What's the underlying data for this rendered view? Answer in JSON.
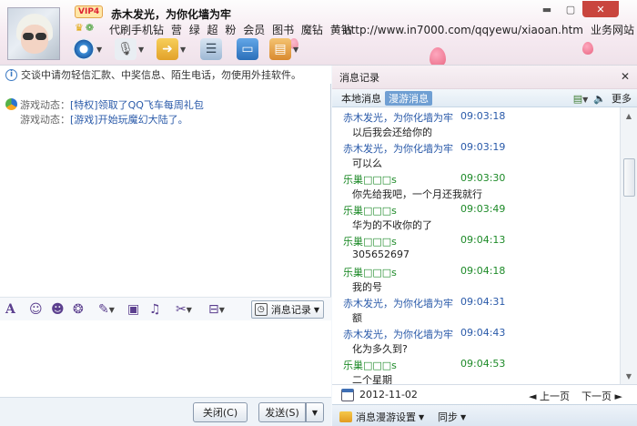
{
  "header": {
    "vip_badge": "VIP4",
    "nickname": "赤木发光，为你化墙为牢",
    "links": [
      "代刷手机钻",
      "营",
      "绿",
      "超",
      "粉",
      "会员",
      "图书",
      "魔钻",
      "黄钻"
    ],
    "url": "http://www.in7000.com/qqyewu/xiaoan.htm",
    "business_site": "业务网站"
  },
  "window_controls": [
    "▬",
    "▢",
    "✕"
  ],
  "notice": "交谈中请勿轻信汇款、中奖信息、陌生电话，勿使用外挂软件。",
  "game_updates": [
    {
      "label": "游戏动态：",
      "text": "[特权]领取了QQ飞车每周礼包"
    },
    {
      "label": "游戏动态：",
      "text": "[游戏]开始玩魔幻大陆了。"
    }
  ],
  "format_bar": {
    "message_record_label": "消息记录"
  },
  "bottom": {
    "close_label": "关闭(C)",
    "send_label": "发送(S)"
  },
  "history": {
    "title": "消息记录",
    "tab_local": "本地消息",
    "tab_roam": "漫游消息",
    "more": "更多",
    "entries": [
      {
        "sender": "赤木发光，为你化墙为牢",
        "time": "09:03:18",
        "text": "以后我会还给你的",
        "color": "blue"
      },
      {
        "sender": "赤木发光，为你化墙为牢",
        "time": "09:03:19",
        "text": "可以么",
        "color": "blue"
      },
      {
        "sender": "乐巢□□□s",
        "time": "09:03:30",
        "text": "你先给我吧，一个月还我就行",
        "color": "green"
      },
      {
        "sender": "乐巢□□□s",
        "time": "09:03:49",
        "text": "华为的不收你的了",
        "color": "green"
      },
      {
        "sender": "乐巢□□□s",
        "time": "09:04:13",
        "text": "305652697",
        "color": "green"
      },
      {
        "sender": "乐巢□□□s",
        "time": "09:04:18",
        "text": "我的号",
        "color": "green"
      },
      {
        "sender": "赤木发光，为你化墙为牢",
        "time": "09:04:31",
        "text": "额",
        "color": "blue"
      },
      {
        "sender": "赤木发光，为你化墙为牢",
        "time": "09:04:43",
        "text": "化为多久到?",
        "color": "blue"
      },
      {
        "sender": "乐巢□□□s",
        "time": "09:04:53",
        "text": "二个星期",
        "color": "green"
      }
    ],
    "date": "2012-11-02",
    "prev_page": "◄ 上一页",
    "next_page": "下一页 ►",
    "roam_settings": "消息漫游设置",
    "sync": "同步"
  },
  "colors": {
    "link_blue": "#2a5aa9",
    "sender_green": "#1d8a28",
    "active_tab": "#6f9fd3"
  }
}
